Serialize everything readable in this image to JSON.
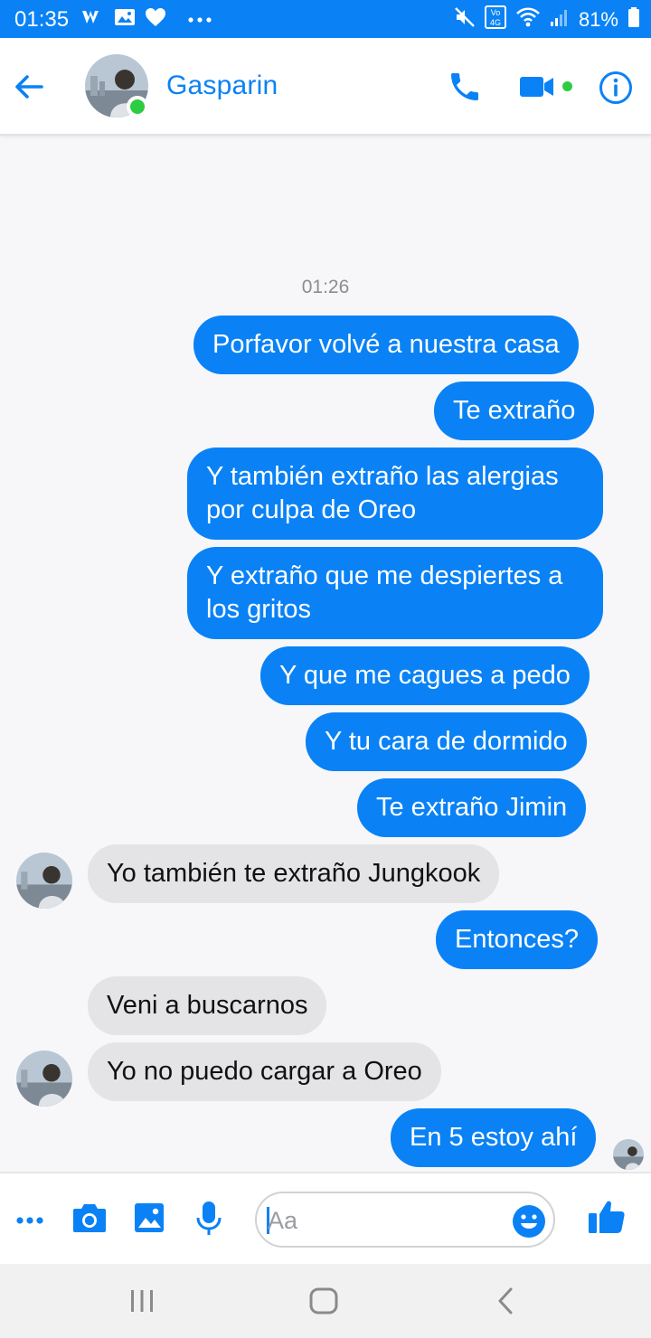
{
  "status_bar": {
    "time": "01:35",
    "battery": "81%",
    "icons": [
      "wattpad-icon",
      "gallery-icon",
      "heart-icon",
      "more-icon",
      "mute-icon",
      "volte-icon",
      "wifi-icon",
      "signal-icon",
      "battery-icon"
    ]
  },
  "header": {
    "contact_name": "Gasparin",
    "online": true,
    "accent_color": "#0a82f5"
  },
  "conversation": {
    "timestamp": "01:26",
    "messages": [
      {
        "from": "me",
        "text": "Porfavor volvé a nuestra casa"
      },
      {
        "from": "me",
        "text": "Te extraño"
      },
      {
        "from": "me",
        "text": "Y también extraño las alergias por culpa de Oreo"
      },
      {
        "from": "me",
        "text": "Y extraño que me despiertes a los gritos"
      },
      {
        "from": "me",
        "text": "Y que me cagues a pedo"
      },
      {
        "from": "me",
        "text": "Y tu cara de dormido"
      },
      {
        "from": "me",
        "text": "Te extraño Jimin"
      },
      {
        "from": "them",
        "text": "Yo también te extraño Jungkook"
      },
      {
        "from": "me",
        "text": "Entonces?"
      },
      {
        "from": "them",
        "text": "Veni a buscarnos"
      },
      {
        "from": "them",
        "text": "Yo no puedo cargar a Oreo"
      },
      {
        "from": "me",
        "text": "En 5 estoy ahí"
      }
    ]
  },
  "composer": {
    "placeholder": "Aa",
    "value": ""
  },
  "nav_bar": {
    "buttons": [
      "recents-button",
      "home-button",
      "back-button"
    ]
  }
}
